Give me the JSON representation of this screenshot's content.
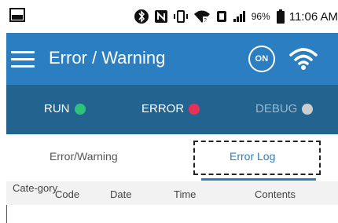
{
  "statusbar": {
    "icons": [
      "gallery-icon",
      "bluetooth-icon",
      "nfc-icon",
      "vibrate-icon",
      "wifi-hotspot-icon",
      "data-icon",
      "signal-icon",
      "battery-icon"
    ],
    "battery_percent": "96%",
    "time": "11:06 AM"
  },
  "appbar": {
    "title": "Error / Warning",
    "on_label": "ON",
    "color": "#2b7fc1"
  },
  "status": {
    "run": {
      "label": "RUN",
      "color": "#2ec27e"
    },
    "error": {
      "label": "ERROR",
      "color": "#e8315a"
    },
    "debug": {
      "label": "DEBUG",
      "color": "#c9ced3"
    }
  },
  "tabs": {
    "warning": "Error/Warning",
    "log": "Error Log",
    "active": "log"
  },
  "table": {
    "headers": [
      "Cate-gory",
      "Code",
      "Date",
      "Time",
      "Contents"
    ]
  }
}
